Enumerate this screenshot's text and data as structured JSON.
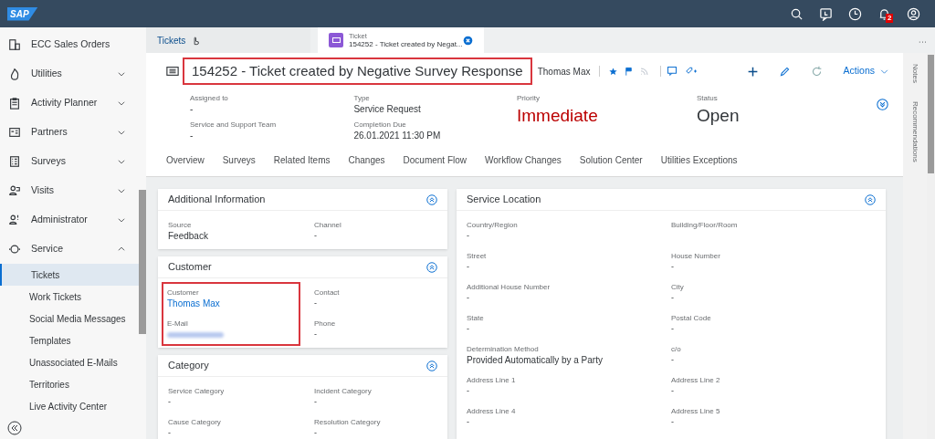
{
  "shell": {
    "logo": "SAP",
    "notification_count": "2"
  },
  "sidebar": {
    "items": [
      {
        "label": "ECC Sales Orders"
      },
      {
        "label": "Utilities",
        "expanded": false
      },
      {
        "label": "Activity Planner",
        "expanded": false
      },
      {
        "label": "Partners",
        "expanded": false
      },
      {
        "label": "Surveys",
        "expanded": false
      },
      {
        "label": "Visits",
        "expanded": false
      },
      {
        "label": "Administrator",
        "expanded": false
      },
      {
        "label": "Service",
        "expanded": true,
        "children": [
          {
            "label": "Tickets",
            "selected": true
          },
          {
            "label": "Work Tickets",
            "selected": false
          },
          {
            "label": "Social Media Messages",
            "selected": false
          },
          {
            "label": "Templates",
            "selected": false
          },
          {
            "label": "Unassociated E-Mails",
            "selected": false
          },
          {
            "label": "Territories",
            "selected": false
          },
          {
            "label": "Live Activity Center",
            "selected": false
          }
        ]
      }
    ]
  },
  "tabs": [
    {
      "label": "Tickets",
      "selected": false
    },
    {
      "kind": "ticket",
      "caption": "Ticket",
      "label": "154252 - Ticket created by Negat...",
      "selected": true
    }
  ],
  "header": {
    "title": "154252 - Ticket created by Negative Survey Response",
    "title_highlighted": true,
    "owner": "Thomas Max",
    "actions_label": "Actions",
    "attributes": [
      {
        "label": "Assigned to",
        "value": "-",
        "kind": "small"
      },
      {
        "label": "Service and Support Team",
        "value": "-",
        "kind": "small"
      },
      {
        "label": "Type",
        "value": "Service Request",
        "kind": "small"
      },
      {
        "label": "Completion Due",
        "value": "26.01.2021 11:30 PM",
        "kind": "small"
      },
      {
        "label": "Priority",
        "value": "Immediate",
        "kind": "large",
        "color": "#bb0000"
      },
      {
        "label": "Status",
        "value": "Open",
        "kind": "large",
        "color": "#32363a"
      }
    ]
  },
  "sections": [
    "Overview",
    "Surveys",
    "Related Items",
    "Changes",
    "Document Flow",
    "Workflow Changes",
    "Solution Center",
    "Utilities Exceptions"
  ],
  "cards_left": [
    {
      "title": "Additional Information",
      "highlighted_fields": false,
      "fields": [
        {
          "label": "Source",
          "value": "Feedback"
        },
        {
          "label": "Channel",
          "value": "-"
        }
      ]
    },
    {
      "title": "Customer",
      "highlighted_fields": true,
      "fields": [
        {
          "label": "Customer",
          "value": "Thomas Max",
          "kind": "link"
        },
        {
          "label": "Contact",
          "value": "-"
        },
        {
          "label": "E-Mail",
          "kind": "blurred"
        },
        {
          "label": "Phone",
          "value": "-"
        }
      ]
    },
    {
      "title": "Category",
      "highlighted_fields": false,
      "fields": [
        {
          "label": "Service Category",
          "value": "-"
        },
        {
          "label": "Incident Category",
          "value": "-"
        },
        {
          "label": "Cause Category",
          "value": "-"
        },
        {
          "label": "Resolution Category",
          "value": "-"
        }
      ]
    }
  ],
  "card_right": {
    "title": "Service Location",
    "fields": [
      {
        "label": "Country/Region",
        "value": "-"
      },
      {
        "label": "Building/Floor/Room"
      },
      {
        "label": "Street",
        "value": "-"
      },
      {
        "label": "House Number",
        "value": "-"
      },
      {
        "label": "Additional House Number",
        "value": "-"
      },
      {
        "label": "City",
        "value": "-"
      },
      {
        "label": "State",
        "value": "-"
      },
      {
        "label": "Postal Code",
        "value": "-"
      },
      {
        "label": "Determination Method",
        "value": "Provided Automatically by a Party"
      },
      {
        "label": "c/o",
        "value": "-"
      },
      {
        "label": "Address Line 1",
        "value": "-"
      },
      {
        "label": "Address Line 2",
        "value": "-"
      },
      {
        "label": "Address Line 4",
        "value": "-"
      },
      {
        "label": "Address Line 5",
        "value": "-"
      }
    ]
  },
  "side_panel": [
    "Notes",
    "Recommendations"
  ]
}
